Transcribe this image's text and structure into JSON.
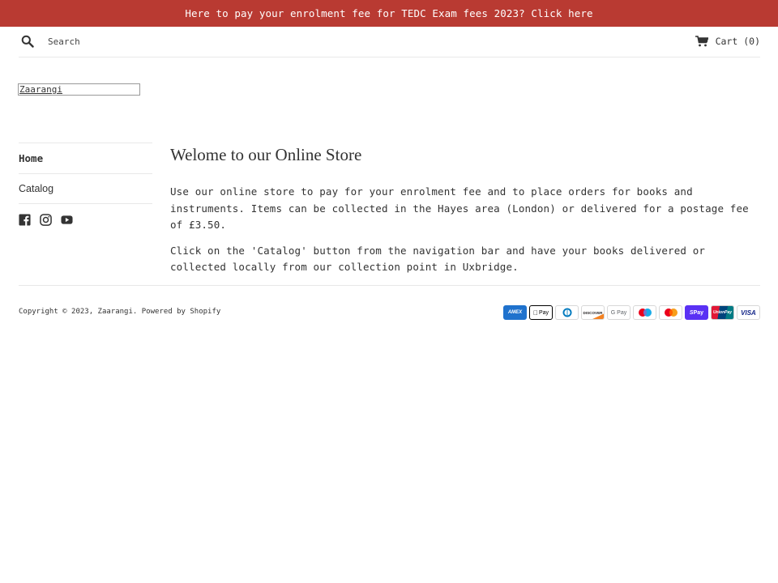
{
  "announcement": {
    "text": "Here to pay your enrolment fee for TEDC Exam fees 2023? Click here",
    "bg_color": "#b93a32"
  },
  "header": {
    "search": {
      "placeholder": "Search",
      "value": "",
      "icon": "search-icon"
    },
    "cart": {
      "label": "Cart",
      "count": "(0)",
      "icon": "cart-icon"
    }
  },
  "logo": {
    "text": "Zaarangi"
  },
  "sidebar": {
    "nav": [
      {
        "label": "Home",
        "active": true
      },
      {
        "label": "Catalog",
        "active": false
      }
    ],
    "social": [
      "facebook-icon",
      "instagram-icon",
      "youtube-icon"
    ]
  },
  "main": {
    "title": "Welome to our Online Store",
    "paragraphs": [
      "Use our online store to pay for your enrolment fee and to place orders for books and instruments. Items can be collected in the Hayes area (London) or delivered for a postage fee of £3.50.",
      "Click on the 'Catalog' button from the navigation bar and have your books delivered or collected locally from our collection point in Uxbridge."
    ]
  },
  "footer": {
    "copyright_prefix": "Copyright © 2023,",
    "store_name": "Zaarangi",
    "separator": ".",
    "powered_by": "Powered by Shopify",
    "payments": [
      {
        "name": "American Express",
        "label": "AMEX",
        "bg": "#1f72cd",
        "fg": "#ffffff"
      },
      {
        "name": "Apple Pay",
        "label": "Pay",
        "bg": "#ffffff",
        "fg": "#000000"
      },
      {
        "name": "Diners Club",
        "label": "",
        "bg": "#ffffff",
        "fg": "#0079be"
      },
      {
        "name": "Discover",
        "label": "DISCOVER",
        "bg": "#ffffff",
        "fg": "#231f20"
      },
      {
        "name": "Google Pay",
        "label": "G Pay",
        "bg": "#ffffff",
        "fg": "#5f6368"
      },
      {
        "name": "Maestro",
        "label": "",
        "bg": "#ffffff",
        "fg": "#000000"
      },
      {
        "name": "Mastercard",
        "label": "",
        "bg": "#ffffff",
        "fg": "#000000"
      },
      {
        "name": "Shop Pay",
        "label": "Pay",
        "bg": "#5a31f4",
        "fg": "#ffffff"
      },
      {
        "name": "Union Pay",
        "label": "UnionPay",
        "bg": "#e21836",
        "fg": "#ffffff"
      },
      {
        "name": "Visa",
        "label": "VISA",
        "bg": "#ffffff",
        "fg": "#142688"
      }
    ]
  }
}
